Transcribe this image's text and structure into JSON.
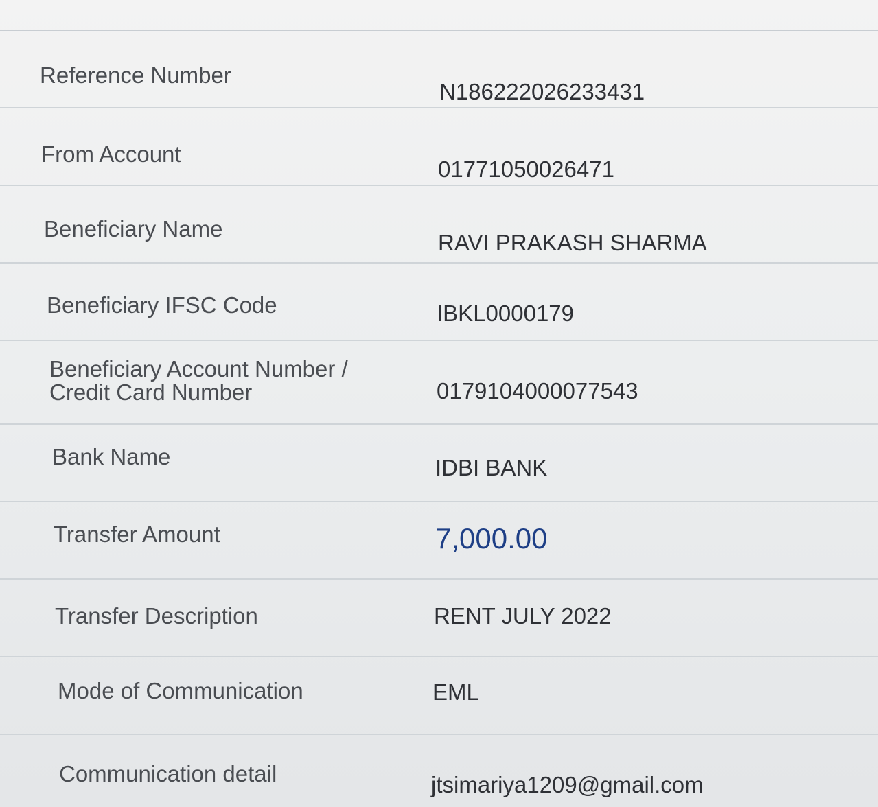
{
  "rows": [
    {
      "label": "Reference Number",
      "value": "N186222026233431"
    },
    {
      "label": "From Account",
      "value": "01771050026471"
    },
    {
      "label": "Beneficiary Name",
      "value": "RAVI PRAKASH SHARMA"
    },
    {
      "label": "Beneficiary IFSC Code",
      "value": "IBKL0000179"
    },
    {
      "label": "Beneficiary Account Number / Credit Card Number",
      "value": "0179104000077543"
    },
    {
      "label": "Bank Name",
      "value": "IDBI BANK"
    },
    {
      "label": "Transfer Amount",
      "value": "7,000.00"
    },
    {
      "label": "Transfer Description",
      "value": "RENT JULY 2022"
    },
    {
      "label": "Mode of Communication",
      "value": "EML"
    },
    {
      "label": "Communication detail",
      "value": "jtsimariya1209@gmail.com"
    }
  ],
  "colors": {
    "amount": "#1e3f86",
    "label": "#4a4d52",
    "value": "#2f3136",
    "divider": "#cfd4d8"
  }
}
